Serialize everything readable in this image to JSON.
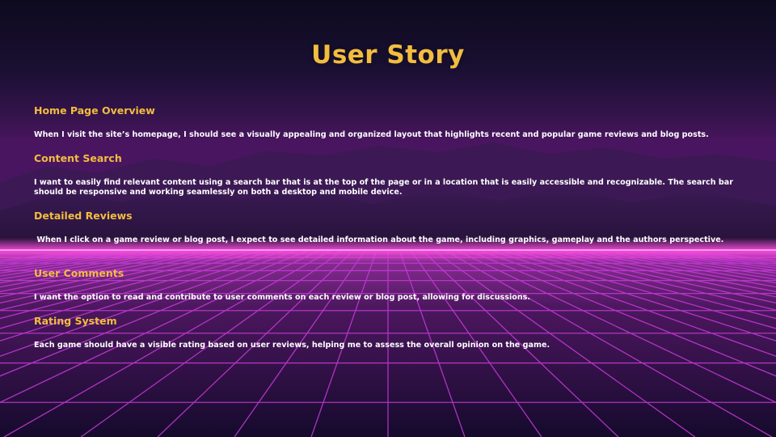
{
  "slide": {
    "title": "User Story",
    "sections": [
      {
        "heading": "Home Page Overview",
        "text": "When I visit the site’s homepage, I should see a visually appealing and organized layout that highlights recent and popular game reviews and blog posts."
      },
      {
        "heading": "Content Search",
        "text": "I want to easily find relevant content using a search bar that is at the top of the page or in a location that is easily accessible and recognizable. The search bar should be responsive and working seamlessly on both a desktop and mobile device."
      },
      {
        "heading": "Detailed Reviews",
        "text": " When I click on a game review or blog post, I expect to see detailed information about the game, including graphics, gameplay and the authors perspective."
      },
      {
        "heading": "User Comments",
        "text": "I want the option to read and contribute to user comments on each review or blog post, allowing for discussions."
      },
      {
        "heading": "Rating System",
        "text": "Each game should have a visible rating based on user reviews, helping me to assess the overall opinion on the game."
      }
    ]
  },
  "colors": {
    "heading": "#f2bd3f",
    "body_text": "#ffffff",
    "sky_top": "#0d0a1e",
    "sky_horizon": "#4a1560",
    "grid_line": "#c63ad8",
    "horizon_glow": "#ff4fe0"
  }
}
